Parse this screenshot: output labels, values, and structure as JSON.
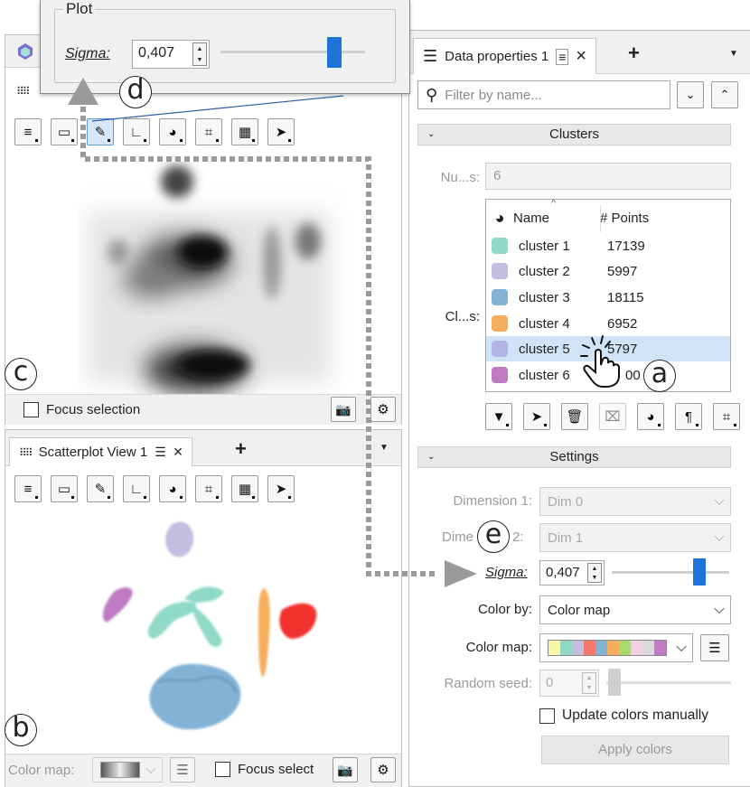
{
  "popup": {
    "group_title": "Plot",
    "sigma_label": "Sigma:",
    "sigma_value": "0,407",
    "slider_value": 0.82
  },
  "left_top": {
    "focus_label": "Focus selection"
  },
  "left_bottom": {
    "tab_title": "Scatterplot View 1",
    "add_tab": "+",
    "color_map_label": "Color map:",
    "focus_label": "Focus select"
  },
  "right": {
    "tab_title": "Data properties 1",
    "add_tab": "+",
    "filter_placeholder": "Filter by name...",
    "clusters_section": "Clusters",
    "num_label": "Nu...s:",
    "num_value": "6",
    "cl_label": "Cl...s:",
    "table": {
      "headers": [
        "Name",
        "# Points"
      ],
      "rows": [
        {
          "name": "cluster 1",
          "points": "17139",
          "color": "#8fd9c6"
        },
        {
          "name": "cluster 2",
          "points": "5997",
          "color": "#c3bde0"
        },
        {
          "name": "cluster 3",
          "points": "18115",
          "color": "#82b3d6"
        },
        {
          "name": "cluster 4",
          "points": "6952",
          "color": "#f7ae5c"
        },
        {
          "name": "cluster 5",
          "points": "5797",
          "color": "#b4b4e4",
          "selected": true
        },
        {
          "name": "cluster 6",
          "points": "00",
          "color": "#c07ac1"
        }
      ]
    },
    "settings_section": "Settings",
    "dim1_label": "Dimension 1:",
    "dim1_value": "Dim 0",
    "dim2_label_a": "Dime",
    "dim2_label_b": "2:",
    "dim2_value": "Dim 1",
    "sigma_label": "Sigma:",
    "sigma_value": "0,407",
    "sigma_slider": 0.78,
    "colorby_label": "Color by:",
    "colorby_value": "Color map",
    "colormap_label": "Color map:",
    "colormap_colors": [
      "#fbf5a7",
      "#8fd9c6",
      "#c3bde0",
      "#f2796b",
      "#82b3d6",
      "#f7ae5c",
      "#a8dc6a",
      "#f4cfe4",
      "#d9d9d9",
      "#c07ac1"
    ],
    "seed_label": "Random seed:",
    "seed_value": "0",
    "update_label": "Update colors manually",
    "apply_label": "Apply colors"
  },
  "callouts": {
    "a": "a",
    "b": "b",
    "c": "c",
    "d": "d",
    "e": "e"
  }
}
